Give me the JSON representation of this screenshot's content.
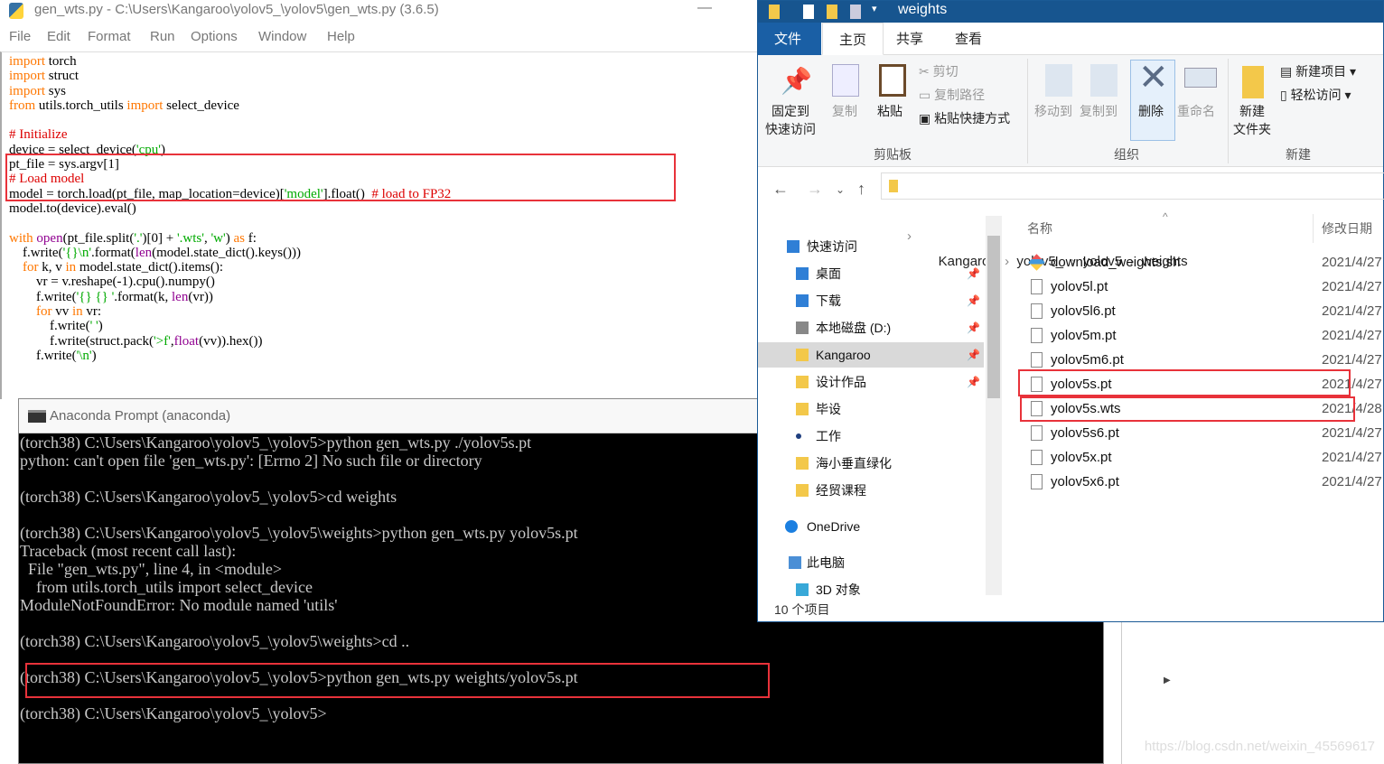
{
  "idle": {
    "title": "gen_wts.py - C:\\Users\\Kangaroo\\yolov5_\\yolov5\\gen_wts.py (3.6.5)",
    "minimize": "—",
    "menu": [
      "File",
      "Edit",
      "Format",
      "Run",
      "Options",
      "Window",
      "Help"
    ],
    "code": [
      [
        [
          "import",
          "kw"
        ],
        [
          " torch",
          ""
        ]
      ],
      [
        [
          "import",
          "kw"
        ],
        [
          " struct",
          ""
        ]
      ],
      [
        [
          "import",
          "kw"
        ],
        [
          " sys",
          ""
        ]
      ],
      [
        [
          "from",
          "kw"
        ],
        [
          " utils.torch_utils ",
          ""
        ],
        [
          "import",
          "kw"
        ],
        [
          " select_device",
          ""
        ]
      ],
      [],
      [
        [
          "# Initialize",
          "cm"
        ]
      ],
      [
        [
          "device = select_device(",
          ""
        ],
        [
          "'cpu'",
          "str"
        ],
        [
          ")",
          ""
        ]
      ],
      [
        [
          "pt_file = sys.argv[1]",
          ""
        ]
      ],
      [
        [
          "# Load model",
          "cm"
        ]
      ],
      [
        [
          "model = torch.load(pt_file, map_location=device)[",
          ""
        ],
        [
          "'model'",
          "str"
        ],
        [
          "].float()  ",
          ""
        ],
        [
          "# load to FP32",
          "cm"
        ]
      ],
      [
        [
          "model.to(device).eval()",
          ""
        ]
      ],
      [],
      [
        [
          "with",
          "kw"
        ],
        [
          " ",
          ""
        ],
        [
          "open",
          "bi"
        ],
        [
          "(pt_file.split(",
          ""
        ],
        [
          "'.'",
          "str"
        ],
        [
          ")[0] + ",
          ""
        ],
        [
          "'.wts'",
          "str"
        ],
        [
          ", ",
          ""
        ],
        [
          "'w'",
          "str"
        ],
        [
          ") ",
          ""
        ],
        [
          "as",
          "kw"
        ],
        [
          " f:",
          ""
        ]
      ],
      [
        [
          "    f.write(",
          ""
        ],
        [
          "'{}\\n'",
          "str"
        ],
        [
          ".format(",
          ""
        ],
        [
          "len",
          "bi"
        ],
        [
          "(model.state_dict().keys()))",
          ""
        ]
      ],
      [
        [
          "    ",
          ""
        ],
        [
          "for",
          "kw"
        ],
        [
          " k, v ",
          ""
        ],
        [
          "in",
          "kw"
        ],
        [
          " model.state_dict().items():",
          ""
        ]
      ],
      [
        [
          "        vr = v.reshape(-1).cpu().numpy()",
          ""
        ]
      ],
      [
        [
          "        f.write(",
          ""
        ],
        [
          "'{} {} '",
          "str"
        ],
        [
          ".format(k, ",
          ""
        ],
        [
          "len",
          "bi"
        ],
        [
          "(vr))",
          ""
        ]
      ],
      [
        [
          "        ",
          ""
        ],
        [
          "for",
          "kw"
        ],
        [
          " vv ",
          ""
        ],
        [
          "in",
          "kw"
        ],
        [
          " vr:",
          ""
        ]
      ],
      [
        [
          "            f.write(",
          ""
        ],
        [
          "' '",
          "str"
        ],
        [
          ")",
          ""
        ]
      ],
      [
        [
          "            f.write(struct.pack(",
          ""
        ],
        [
          "'>f'",
          "str"
        ],
        [
          ",",
          ""
        ],
        [
          "float",
          "bi"
        ],
        [
          "(vv)).hex())",
          ""
        ]
      ],
      [
        [
          "        f.write(",
          ""
        ],
        [
          "'\\n'",
          "str"
        ],
        [
          ")",
          ""
        ]
      ]
    ]
  },
  "terminal": {
    "title": "Anaconda Prompt (anaconda)",
    "lines": [
      "(torch38) C:\\Users\\Kangaroo\\yolov5_\\yolov5>python gen_wts.py ./yolov5s.pt",
      "python: can't open file 'gen_wts.py': [Errno 2] No such file or directory",
      "",
      "(torch38) C:\\Users\\Kangaroo\\yolov5_\\yolov5>cd weights",
      "",
      "(torch38) C:\\Users\\Kangaroo\\yolov5_\\yolov5\\weights>python gen_wts.py yolov5s.pt",
      "Traceback (most recent call last):",
      "  File \"gen_wts.py\", line 4, in <module>",
      "    from utils.torch_utils import select_device",
      "ModuleNotFoundError: No module named 'utils'",
      "",
      "(torch38) C:\\Users\\Kangaroo\\yolov5_\\yolov5\\weights>cd ..",
      "",
      "(torch38) C:\\Users\\Kangaroo\\yolov5_\\yolov5>python gen_wts.py weights/yolov5s.pt",
      "",
      "(torch38) C:\\Users\\Kangaroo\\yolov5_\\yolov5>"
    ]
  },
  "explorer": {
    "title": "weights",
    "tabs": [
      "文件",
      "主页",
      "共享",
      "查看"
    ],
    "ribbon": {
      "pin": "固定到\n快速访问",
      "copy": "复制",
      "paste": "粘贴",
      "cut": "剪切",
      "copy_path": "复制路径",
      "paste_shortcut": "粘贴快捷方式",
      "clipboard_group": "剪贴板",
      "move_to": "移动到",
      "copy_to": "复制到",
      "delete": "删除",
      "rename": "重命名",
      "organize_group": "组织",
      "new_folder": "新建\n文件夹",
      "new_item": "新建项目 ▾",
      "easy_access": "轻松访问 ▾",
      "new_group": "新建"
    },
    "breadcrumb": [
      "Kangaroo",
      "yolov5_",
      "yolov5",
      "weights"
    ],
    "nav": [
      {
        "label": "快速访问",
        "pin": false
      },
      {
        "label": "桌面",
        "pin": true
      },
      {
        "label": "下载",
        "pin": true
      },
      {
        "label": "本地磁盘 (D:)",
        "pin": true
      },
      {
        "label": "Kangaroo",
        "pin": true,
        "selected": true
      },
      {
        "label": "设计作品",
        "pin": true
      },
      {
        "label": "毕设",
        "pin": false
      },
      {
        "label": "工作",
        "pin": false
      },
      {
        "label": "海小垂直绿化",
        "pin": false
      },
      {
        "label": "经贸课程",
        "pin": false
      },
      {
        "label": "OneDrive",
        "pin": false
      },
      {
        "label": "此电脑",
        "pin": false
      },
      {
        "label": "3D 对象",
        "pin": false
      }
    ],
    "columns": {
      "name": "名称",
      "modified": "修改日期"
    },
    "files": [
      {
        "name": "download_weights.sh",
        "date": "2021/4/27"
      },
      {
        "name": "yolov5l.pt",
        "date": "2021/4/27"
      },
      {
        "name": "yolov5l6.pt",
        "date": "2021/4/27"
      },
      {
        "name": "yolov5m.pt",
        "date": "2021/4/27"
      },
      {
        "name": "yolov5m6.pt",
        "date": "2021/4/27"
      },
      {
        "name": "yolov5s.pt",
        "date": "2021/4/27"
      },
      {
        "name": "yolov5s.wts",
        "date": "2021/4/28"
      },
      {
        "name": "yolov5s6.pt",
        "date": "2021/4/27"
      },
      {
        "name": "yolov5x.pt",
        "date": "2021/4/27"
      },
      {
        "name": "yolov5x6.pt",
        "date": "2021/4/27"
      }
    ],
    "status": "10 个项目"
  },
  "watermark": "https://blog.csdn.net/weixin_45569617",
  "colors": {
    "highlight_box": "#e8323a",
    "explorer_titlebar": "#17558f",
    "keyword": "#ff7700",
    "string": "#00aa00",
    "comment": "#dd0000",
    "builtin": "#900090"
  }
}
